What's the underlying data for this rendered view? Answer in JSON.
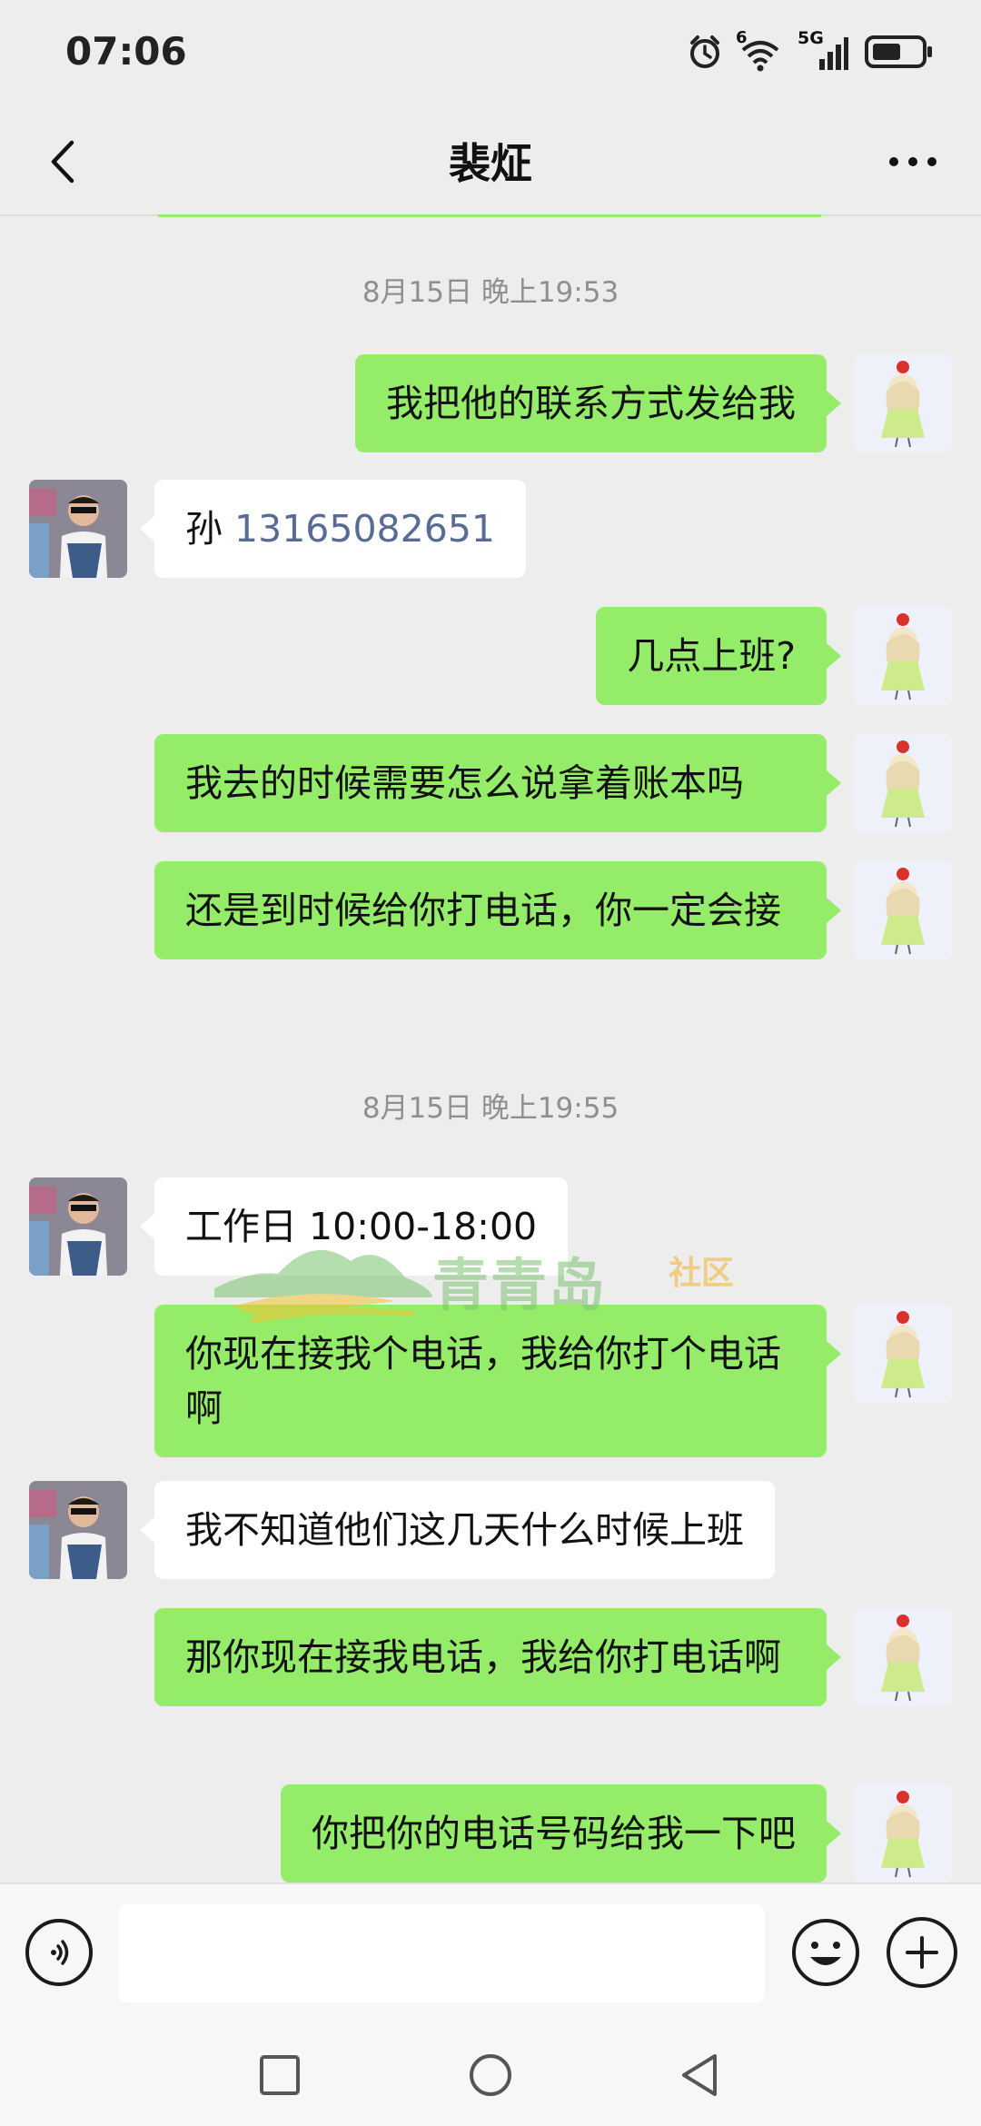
{
  "status": {
    "time": "07:06",
    "network_label": "5G",
    "wifi_label": "6"
  },
  "header": {
    "title": "裴炡"
  },
  "messages": [
    {
      "type": "timestamp",
      "text": "8月15日 晚上19:53"
    },
    {
      "type": "out",
      "text": "我把他的联系方式发给我"
    },
    {
      "type": "in",
      "prefix": "孙 ",
      "phone": "13165082651"
    },
    {
      "type": "out",
      "text": "几点上班?"
    },
    {
      "type": "out",
      "text": "我去的时候需要怎么说拿着账本吗"
    },
    {
      "type": "out",
      "text": "还是到时候给你打电话，你一定会接"
    },
    {
      "type": "timestamp",
      "text": "8月15日 晚上19:55"
    },
    {
      "type": "in",
      "text": "工作日 10:00-18:00"
    },
    {
      "type": "out",
      "text": "你现在接我个电话，我给你打个电话啊"
    },
    {
      "type": "in",
      "text": "我不知道他们这几天什么时候上班"
    },
    {
      "type": "out",
      "text": "那你现在接我电话，我给你打电话啊"
    },
    {
      "type": "out",
      "text": "你把你的电话号码给我一下吧"
    }
  ],
  "watermark": {
    "name": "青青岛",
    "suffix": "社区"
  },
  "input": {
    "placeholder": ""
  },
  "colors": {
    "bubble_out": "#95ec69",
    "bubble_in": "#ffffff",
    "background": "#ededed",
    "phone_link": "#576b95"
  },
  "icons": [
    "chevron-left-icon",
    "more-icon",
    "voice-icon",
    "emoji-icon",
    "plus-icon",
    "alarm-icon",
    "wifi-icon",
    "signal-icon",
    "battery-icon",
    "square-nav-icon",
    "circle-nav-icon",
    "triangle-back-icon"
  ]
}
